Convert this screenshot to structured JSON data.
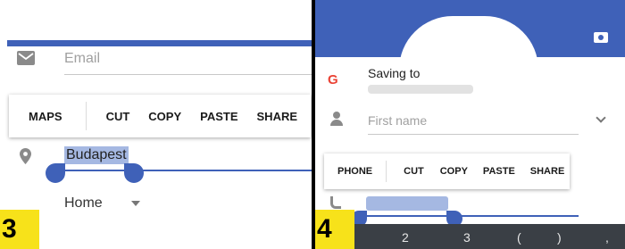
{
  "left": {
    "email_placeholder": "Email",
    "context_menu": [
      "MAPS",
      "CUT",
      "COPY",
      "PASTE",
      "SHARE"
    ],
    "city_value": "Budapest",
    "type_value": "Home",
    "step_number": "3"
  },
  "right": {
    "saving_to_label": "Saving to",
    "first_name_placeholder": "First name",
    "context_menu": [
      "PHONE",
      "CUT",
      "COPY",
      "PASTE",
      "SHARE"
    ],
    "keyboard_keys": [
      "2",
      "3",
      "(",
      ")",
      ","
    ],
    "step_number": "4"
  },
  "colors": {
    "accent": "#3f61b8",
    "selection": "#a5b8e2",
    "step_badge": "#f7e21a",
    "keyboard": "#3a3f45"
  },
  "icons": [
    "mail-icon",
    "location-pin-icon",
    "dropdown-arrow-icon",
    "camera-icon",
    "google-icon",
    "person-icon",
    "chevron-down-icon",
    "phone-icon"
  ]
}
